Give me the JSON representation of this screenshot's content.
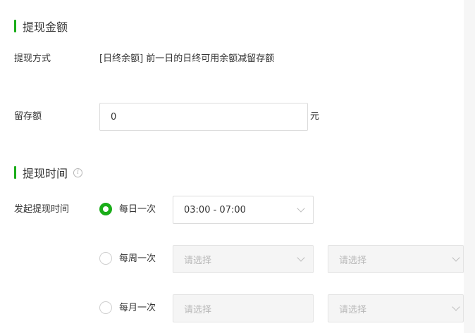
{
  "section_amount": {
    "title": "提现金额"
  },
  "method": {
    "label": "提现方式",
    "value": "[日终余额] 前一日的日终可用余额减留存额"
  },
  "reserve": {
    "label": "留存额",
    "value": "0",
    "unit": "元"
  },
  "section_time": {
    "title": "提现时间"
  },
  "trigger": {
    "label": "发起提现时间",
    "options": [
      {
        "label": "每日一次",
        "checked": true,
        "time_value": "03:00 - 07:00"
      },
      {
        "label": "每周一次",
        "checked": false,
        "placeholder_1": "请选择",
        "placeholder_2": "请选择"
      },
      {
        "label": "每月一次",
        "checked": false,
        "placeholder_1": "请选择",
        "placeholder_2": "请选择"
      }
    ]
  },
  "colors": {
    "accent": "#1aad19",
    "text": "#333333",
    "border": "#dcdcdc",
    "disabled_bg": "#f5f5f5",
    "placeholder": "#b8b8b8"
  },
  "icons": {
    "info": "info-circle-icon",
    "dropdown": "chevron-down-icon"
  }
}
